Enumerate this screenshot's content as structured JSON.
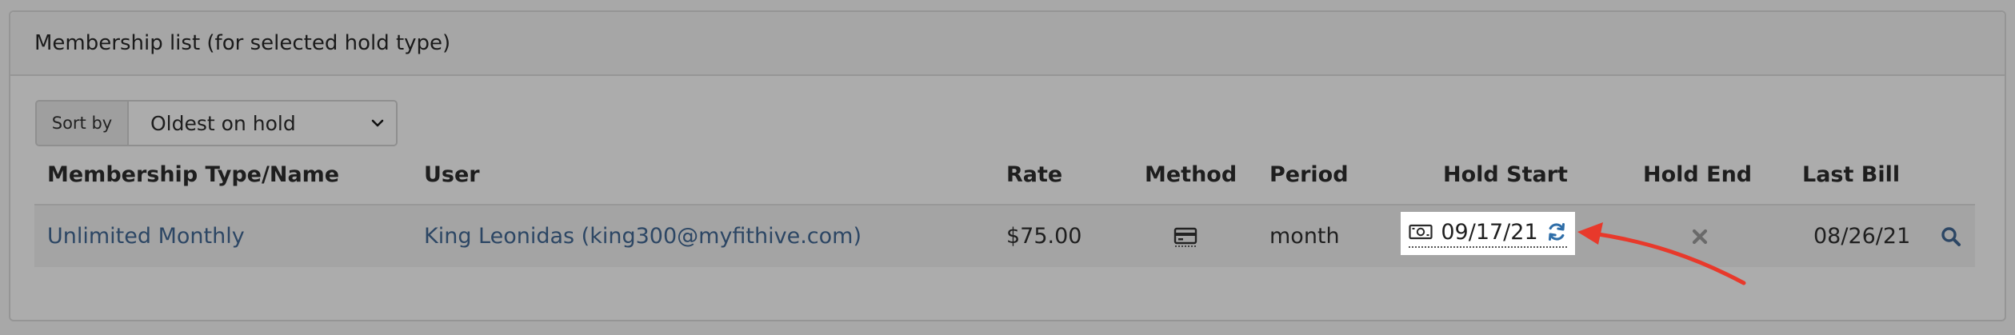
{
  "panel": {
    "title": "Membership list (for selected hold type)"
  },
  "sort": {
    "label": "Sort by",
    "selected": "Oldest on hold"
  },
  "table": {
    "headers": {
      "type": "Membership Type/Name",
      "user": "User",
      "rate": "Rate",
      "method": "Method",
      "period": "Period",
      "hold_start": "Hold Start",
      "hold_end": "Hold End",
      "last_bill": "Last Bill"
    },
    "rows": [
      {
        "type": "Unlimited Monthly",
        "user": "King Leonidas (king300@myfithive.com)",
        "rate": "$75.00",
        "method_icon": "credit-card-icon",
        "period": "month",
        "hold_start": "09/17/21",
        "hold_end_icon": "close-icon",
        "last_bill": "08/26/21"
      }
    ]
  },
  "colors": {
    "overlay_gray": "#a8a8a8",
    "link": "#2c4664",
    "refresh_icon": "#2f6ea8",
    "annotation_arrow": "#e8392b"
  }
}
